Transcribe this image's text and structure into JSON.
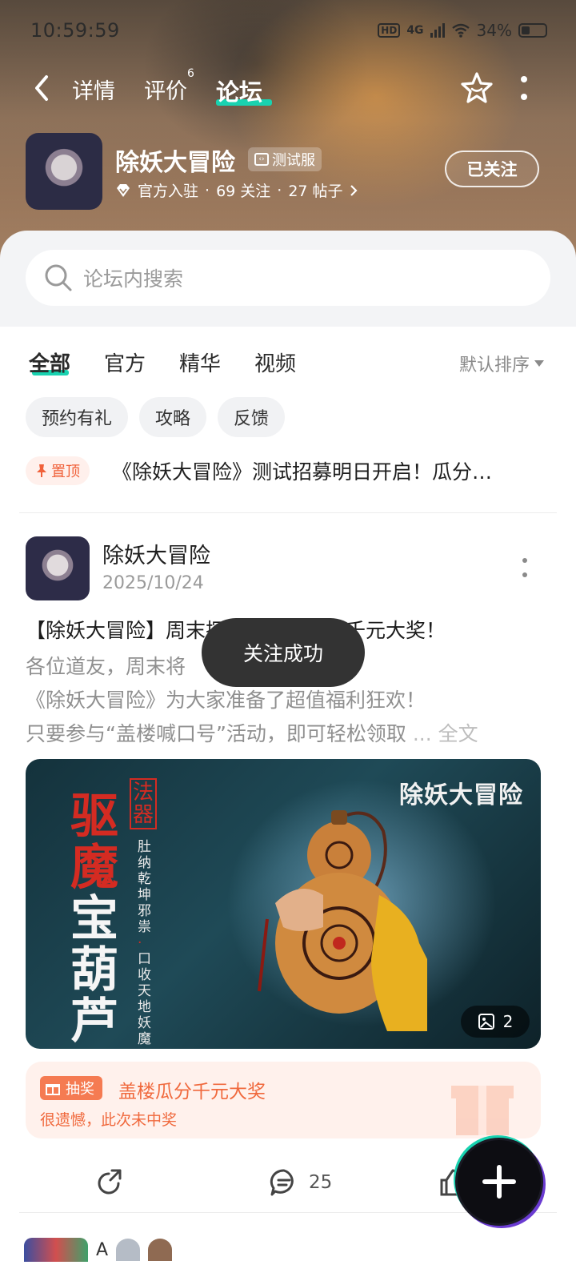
{
  "status": {
    "time": "10:59:59",
    "network": "4G",
    "hd": "HD",
    "battery": "34%"
  },
  "nav": {
    "tabs": [
      "详情",
      "评价",
      "论坛"
    ],
    "review_count": "6",
    "active_tab": "论坛"
  },
  "game": {
    "name": "除妖大冒险",
    "badge": "测试服",
    "official": "官方入驻",
    "followers": "69 关注",
    "posts": "27 帖子",
    "follow_label": "已关注"
  },
  "search": {
    "placeholder": "论坛内搜索"
  },
  "filters": {
    "tabs": [
      "全部",
      "官方",
      "精华",
      "视频"
    ],
    "sort": "默认排序",
    "chips": [
      "预约有礼",
      "攻略",
      "反馈"
    ]
  },
  "pinned": {
    "badge": "置顶",
    "title": "《除妖大冒险》测试招募明日开启！瓜分…"
  },
  "post": {
    "author": "除妖大冒险",
    "date": "2025/10/24",
    "title": "【除妖大冒险】周末探险有礼！瓜分千元大奖！",
    "body_lines": [
      "各位道友，周末将",
      "《除妖大冒险》为大家准备了超值福利狂欢！",
      "只要参与“盖楼喊口号”活动，即可轻松领取"
    ],
    "ellipsis": "...",
    "read_more": "全文",
    "image": {
      "brand": "除妖大冒险",
      "tag": "法器",
      "headline_red": "驱魔",
      "headline_white": "宝葫芦",
      "slogan_a": "肚纳乾坤邪祟",
      "slogan_sep": "·",
      "slogan_b": "口收天地妖魔",
      "count": "2"
    },
    "lottery": {
      "tag": "抽奖",
      "title": "盖楼瓜分千元大奖",
      "result": "很遗憾，此次未中奖"
    },
    "comments": "25"
  },
  "next_post": {
    "initial": "A"
  },
  "toast": "关注成功",
  "colors": {
    "accent": "#19d2b0",
    "lottery": "#f0693d",
    "pin": "#f0613a"
  }
}
